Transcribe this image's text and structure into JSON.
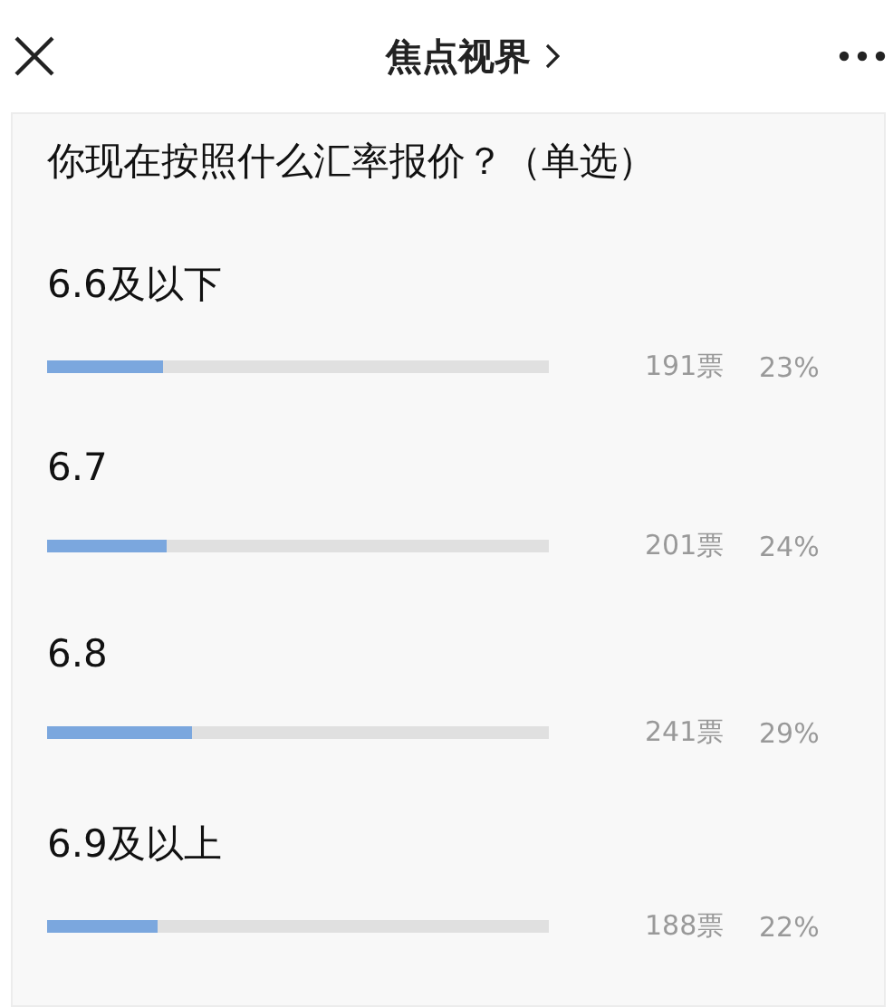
{
  "header": {
    "title": "焦点视界"
  },
  "poll": {
    "question": "你现在按照什么汇率报价？（单选）",
    "options": [
      {
        "label": "6.6及以下",
        "level": 0.23,
        "votes": "191票",
        "percent": "23%"
      },
      {
        "label": "6.7",
        "level": 0.24,
        "votes": "201票",
        "percent": "24%"
      },
      {
        "label": "6.8",
        "level": 0.29,
        "votes": "241票",
        "percent": "29%"
      },
      {
        "label": "6.9及以上",
        "level": 0.22,
        "votes": "188票",
        "percent": "22%"
      }
    ]
  }
}
